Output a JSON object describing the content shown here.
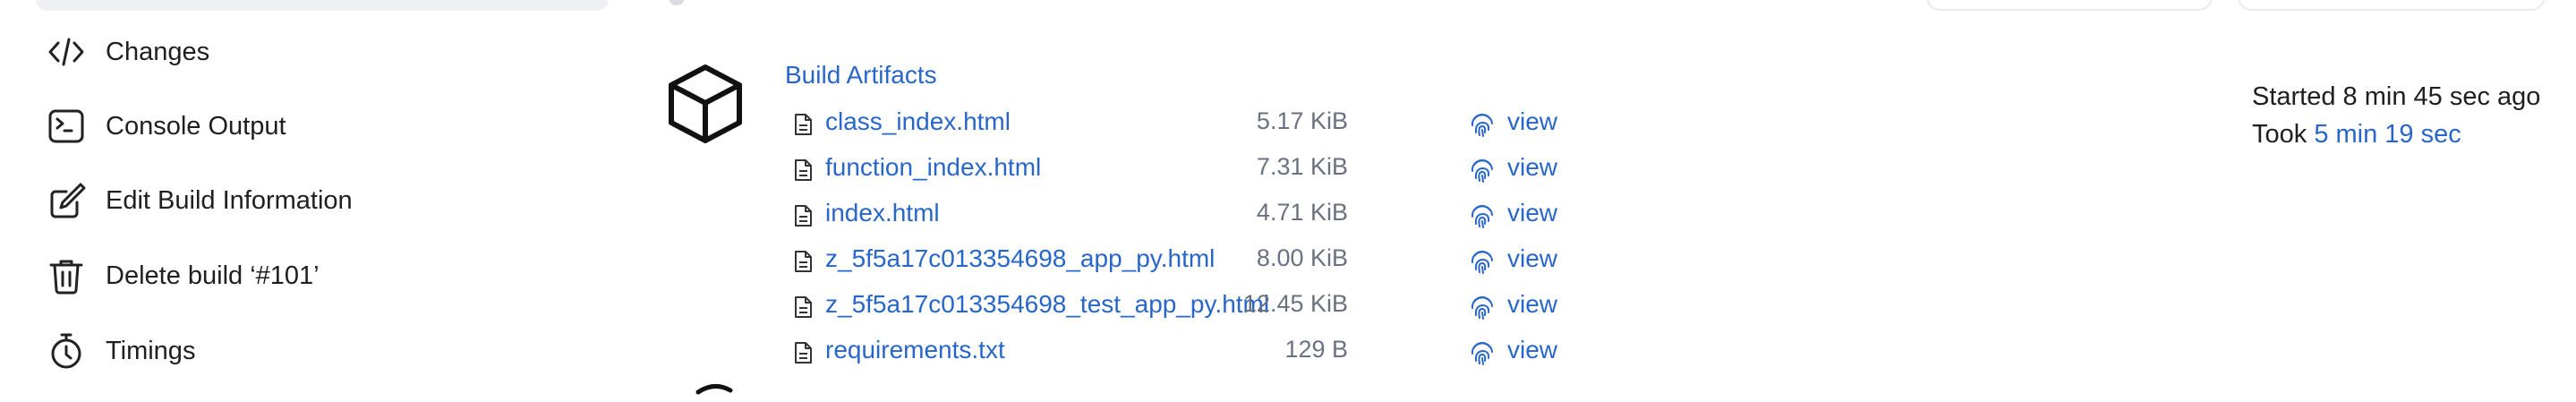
{
  "sidebar": {
    "items": [
      {
        "label": "Changes",
        "icon": "code-icon"
      },
      {
        "label": "Console Output",
        "icon": "terminal-icon"
      },
      {
        "label": "Edit Build Information",
        "icon": "edit-icon"
      },
      {
        "label": "Delete build ‘#101’",
        "icon": "trash-icon"
      },
      {
        "label": "Timings",
        "icon": "stopwatch-icon"
      }
    ]
  },
  "artifacts": {
    "title": "Build Artifacts",
    "icon": "package-icon",
    "files": [
      {
        "name": "class_index.html",
        "size": "5.17 KiB",
        "action": "view"
      },
      {
        "name": "function_index.html",
        "size": "7.31 KiB",
        "action": "view"
      },
      {
        "name": "index.html",
        "size": "4.71 KiB",
        "action": "view"
      },
      {
        "name": "z_5f5a17c013354698_app_py.html",
        "size": "8.00 KiB",
        "action": "view"
      },
      {
        "name": "z_5f5a17c013354698_test_app_py.html",
        "size": "12.45 KiB",
        "action": "view"
      },
      {
        "name": "requirements.txt",
        "size": "129 B",
        "action": "view"
      }
    ]
  },
  "build_info": {
    "started": "Started 8 min 45 sec ago",
    "took_prefix": "Took",
    "duration": "5 min 19 sec"
  },
  "colors": {
    "link": "#2867c9",
    "muted": "#6a7280",
    "text": "#1f1f1f"
  }
}
